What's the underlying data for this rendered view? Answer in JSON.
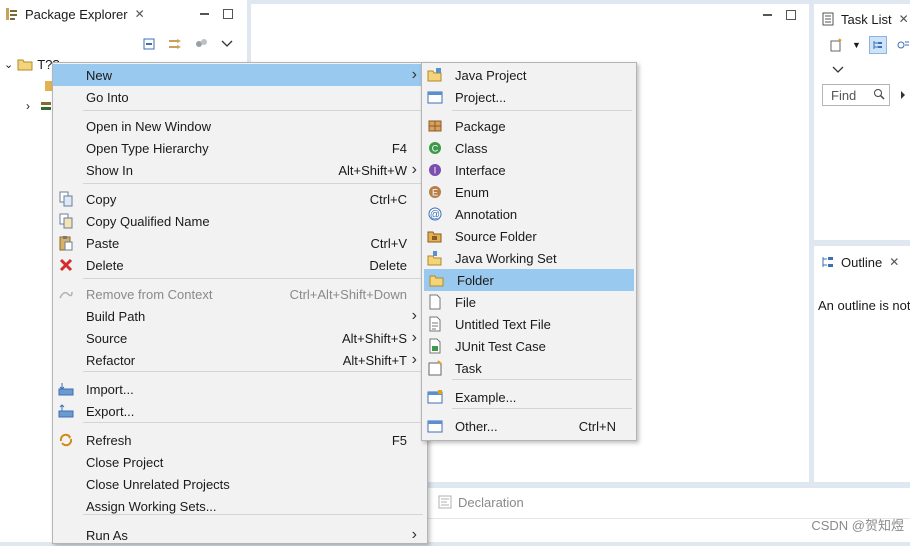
{
  "package_explorer": {
    "title": "Package Explorer",
    "tree_root_label": "T??"
  },
  "task_list": {
    "title": "Task List",
    "find_placeholder": "Find"
  },
  "outline": {
    "title": "Outline",
    "message": "An outline is not"
  },
  "bottom_panel": {
    "declaration_tab": "Declaration"
  },
  "context_menu": {
    "items": [
      {
        "label": "New",
        "accel": "",
        "icon": "none"
      },
      {
        "label": "Go Into",
        "accel": "",
        "icon": "none"
      },
      {
        "label": "Open in New Window",
        "accel": "",
        "icon": "none"
      },
      {
        "label": "Open Type Hierarchy",
        "accel": "F4",
        "icon": "none"
      },
      {
        "label": "Show In",
        "accel": "Alt+Shift+W",
        "icon": "none"
      },
      {
        "label": "Copy",
        "accel": "Ctrl+C",
        "icon": "copy-icon"
      },
      {
        "label": "Copy Qualified Name",
        "accel": "",
        "icon": "copy-qualified-icon"
      },
      {
        "label": "Paste",
        "accel": "Ctrl+V",
        "icon": "paste-icon"
      },
      {
        "label": "Delete",
        "accel": "Delete",
        "icon": "delete-icon"
      },
      {
        "label": "Remove from Context",
        "accel": "Ctrl+Alt+Shift+Down",
        "icon": "remove-context-icon"
      },
      {
        "label": "Build Path",
        "accel": "",
        "icon": "none"
      },
      {
        "label": "Source",
        "accel": "Alt+Shift+S",
        "icon": "none"
      },
      {
        "label": "Refactor",
        "accel": "Alt+Shift+T",
        "icon": "none"
      },
      {
        "label": "Import...",
        "accel": "",
        "icon": "import-icon"
      },
      {
        "label": "Export...",
        "accel": "",
        "icon": "export-icon"
      },
      {
        "label": "Refresh",
        "accel": "F5",
        "icon": "refresh-icon"
      },
      {
        "label": "Close Project",
        "accel": "",
        "icon": "none"
      },
      {
        "label": "Close Unrelated Projects",
        "accel": "",
        "icon": "none"
      },
      {
        "label": "Assign Working Sets...",
        "accel": "",
        "icon": "none"
      },
      {
        "label": "Run As",
        "accel": "",
        "icon": "none"
      }
    ]
  },
  "submenu_new": {
    "items": [
      {
        "label": "Java Project",
        "accel": "",
        "icon": "java-project-icon"
      },
      {
        "label": "Project...",
        "accel": "",
        "icon": "project-icon"
      },
      {
        "label": "Package",
        "accel": "",
        "icon": "package-icon"
      },
      {
        "label": "Class",
        "accel": "",
        "icon": "class-icon"
      },
      {
        "label": "Interface",
        "accel": "",
        "icon": "interface-icon"
      },
      {
        "label": "Enum",
        "accel": "",
        "icon": "enum-icon"
      },
      {
        "label": "Annotation",
        "accel": "",
        "icon": "annotation-icon"
      },
      {
        "label": "Source Folder",
        "accel": "",
        "icon": "source-folder-icon"
      },
      {
        "label": "Java Working Set",
        "accel": "",
        "icon": "working-set-icon"
      },
      {
        "label": "Folder",
        "accel": "",
        "icon": "folder-icon"
      },
      {
        "label": "File",
        "accel": "",
        "icon": "file-icon"
      },
      {
        "label": "Untitled Text File",
        "accel": "",
        "icon": "text-file-icon"
      },
      {
        "label": "JUnit Test Case",
        "accel": "",
        "icon": "junit-icon"
      },
      {
        "label": "Task",
        "accel": "",
        "icon": "task-icon"
      },
      {
        "label": "Example...",
        "accel": "",
        "icon": "example-icon"
      },
      {
        "label": "Other...",
        "accel": "Ctrl+N",
        "icon": "other-icon"
      }
    ]
  },
  "watermark": "CSDN @贺知煜",
  "colors": {
    "selection": "#99c9ef",
    "menu_background": "#f2f2f2",
    "workbench_background": "#dfe7f1"
  }
}
